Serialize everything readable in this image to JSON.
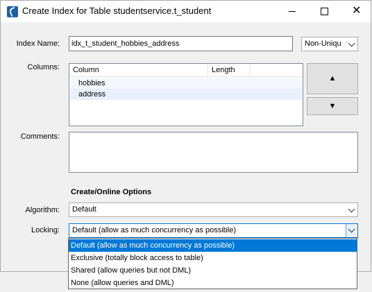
{
  "window": {
    "title": "Create Index for Table studentservice.t_student",
    "min_label": "",
    "max_label": "",
    "close_label": "✕"
  },
  "form": {
    "index_name_label": "Index Name:",
    "index_name_value": "idx_t_student_hobbies_address",
    "uniqueness_value": "Non-Uniqu",
    "columns_label": "Columns:",
    "comments_label": "Comments:",
    "comments_value": ""
  },
  "columns_table": {
    "headers": [
      "Column",
      "Length"
    ],
    "rows": [
      {
        "column": "hobbies",
        "length": ""
      },
      {
        "column": "address",
        "length": ""
      }
    ]
  },
  "move_buttons": {
    "up_label": "▲",
    "down_label": "▼"
  },
  "options": {
    "section_title": "Create/Online Options",
    "algorithm_label": "Algorithm:",
    "algorithm_value": "Default",
    "locking_label": "Locking:",
    "locking_value": "Default (allow as much concurrency as possible)",
    "locking_options": [
      "Default (allow as much concurrency as possible)",
      "Exclusive (totally block access to table)",
      "Shared (allow queries but not DML)",
      "None (allow queries and DML)"
    ],
    "locking_selected_index": 0
  },
  "colors": {
    "selection": "#0078d7",
    "row_highlight": "#e8f0fb",
    "focus_border": "#0078d7"
  },
  "icons": {
    "app": "mysql-workbench-icon",
    "minimize": "minimize-icon",
    "maximize": "maximize-icon",
    "close": "close-icon"
  }
}
